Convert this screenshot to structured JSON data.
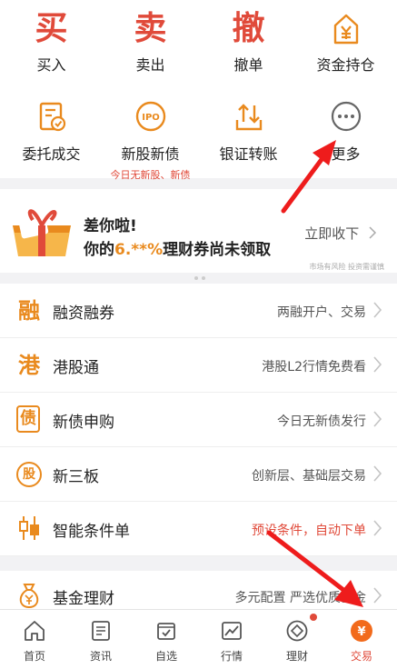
{
  "quick_actions": [
    {
      "glyph": "买",
      "label": "买入"
    },
    {
      "glyph": "卖",
      "label": "卖出"
    },
    {
      "glyph": "撤",
      "label": "撤单"
    },
    {
      "icon": "money-bag-icon",
      "label": "资金持仓"
    }
  ],
  "quick_actions_row2": [
    {
      "icon": "order-record-icon",
      "label": "委托成交"
    },
    {
      "icon": "ipo-icon",
      "label": "新股新债",
      "sub": "今日无新股、新债"
    },
    {
      "icon": "transfer-icon",
      "label": "银证转账"
    },
    {
      "icon": "more-icon",
      "label": "更多"
    }
  ],
  "promo": {
    "line1": "差你啦!",
    "line2_prefix": "你的",
    "line2_highlight": "6.**%",
    "line2_suffix": "理财券尚未领取",
    "cta": "立即收下",
    "foot": "市场有风险 投资需谨慎"
  },
  "services": [
    {
      "icon_glyph": "融",
      "title": "融资融券",
      "desc": "两融开户、交易",
      "desc_color": "normal"
    },
    {
      "icon_glyph": "港",
      "title": "港股通",
      "desc": "港股L2行情免费看",
      "desc_color": "normal"
    },
    {
      "icon_glyph": "债",
      "title": "新债申购",
      "desc": "今日无新债发行",
      "desc_color": "normal"
    },
    {
      "icon_glyph": "股",
      "title": "新三板",
      "desc": "创新层、基础层交易",
      "desc_color": "normal"
    },
    {
      "icon_glyph": "☰",
      "title": "智能条件单",
      "desc": "预设条件，自动下单",
      "desc_color": "red"
    }
  ],
  "services2": [
    {
      "icon_glyph": "¥",
      "title": "基金理财",
      "desc": "多元配置 严选优质基金"
    }
  ],
  "tabs": [
    {
      "icon": "home-icon",
      "label": "首页"
    },
    {
      "icon": "news-icon",
      "label": "资讯"
    },
    {
      "icon": "watchlist-icon",
      "label": "自选"
    },
    {
      "icon": "market-icon",
      "label": "行情"
    },
    {
      "icon": "wealth-icon",
      "label": "理财"
    },
    {
      "icon": "trade-icon",
      "label": "交易",
      "active": true
    }
  ],
  "colors": {
    "accent": "#e04a3a",
    "orange": "#e98a1e"
  }
}
